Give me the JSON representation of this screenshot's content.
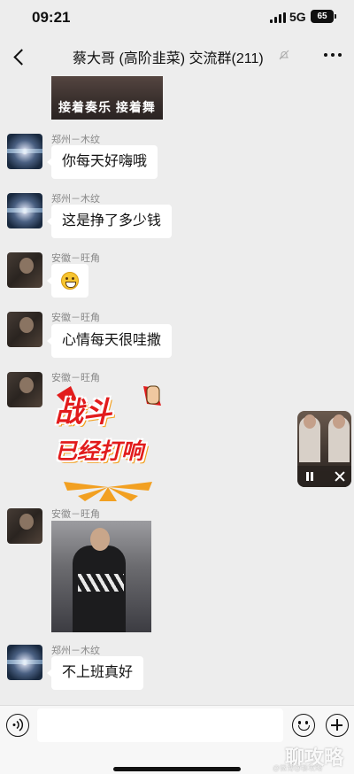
{
  "status_bar": {
    "time": "09:21",
    "network": "5G",
    "battery": "65"
  },
  "header": {
    "title": "蔡大哥 (高阶韭菜) 交流群(211)"
  },
  "top_image": {
    "caption": "接着奏乐 接着舞"
  },
  "messages": [
    {
      "sender": "郑州－木纹",
      "text": "你每天好嗨哦"
    },
    {
      "sender": "郑州－木纹",
      "text": "这是挣了多少钱"
    },
    {
      "sender": "安徽－旺角",
      "emoji": "grinning-face"
    },
    {
      "sender": "安徽－旺角",
      "text": "心情每天很哇撒"
    },
    {
      "sender": "安徽－旺角",
      "sticker_line1": "战斗",
      "sticker_line2": "已经打响"
    },
    {
      "sender": "安徽－旺角",
      "image": "dancing-person-photo"
    },
    {
      "sender": "郑州－木纹",
      "text": "不上班真好"
    }
  ],
  "input": {
    "placeholder": ""
  },
  "watermark": {
    "main": "聊攻略",
    "sub": "@微博@聊攻略"
  },
  "colors": {
    "background": "#ededed",
    "bubble": "#ffffff",
    "sticker_red": "#e21c1c",
    "sticker_orange": "#f2a021"
  }
}
